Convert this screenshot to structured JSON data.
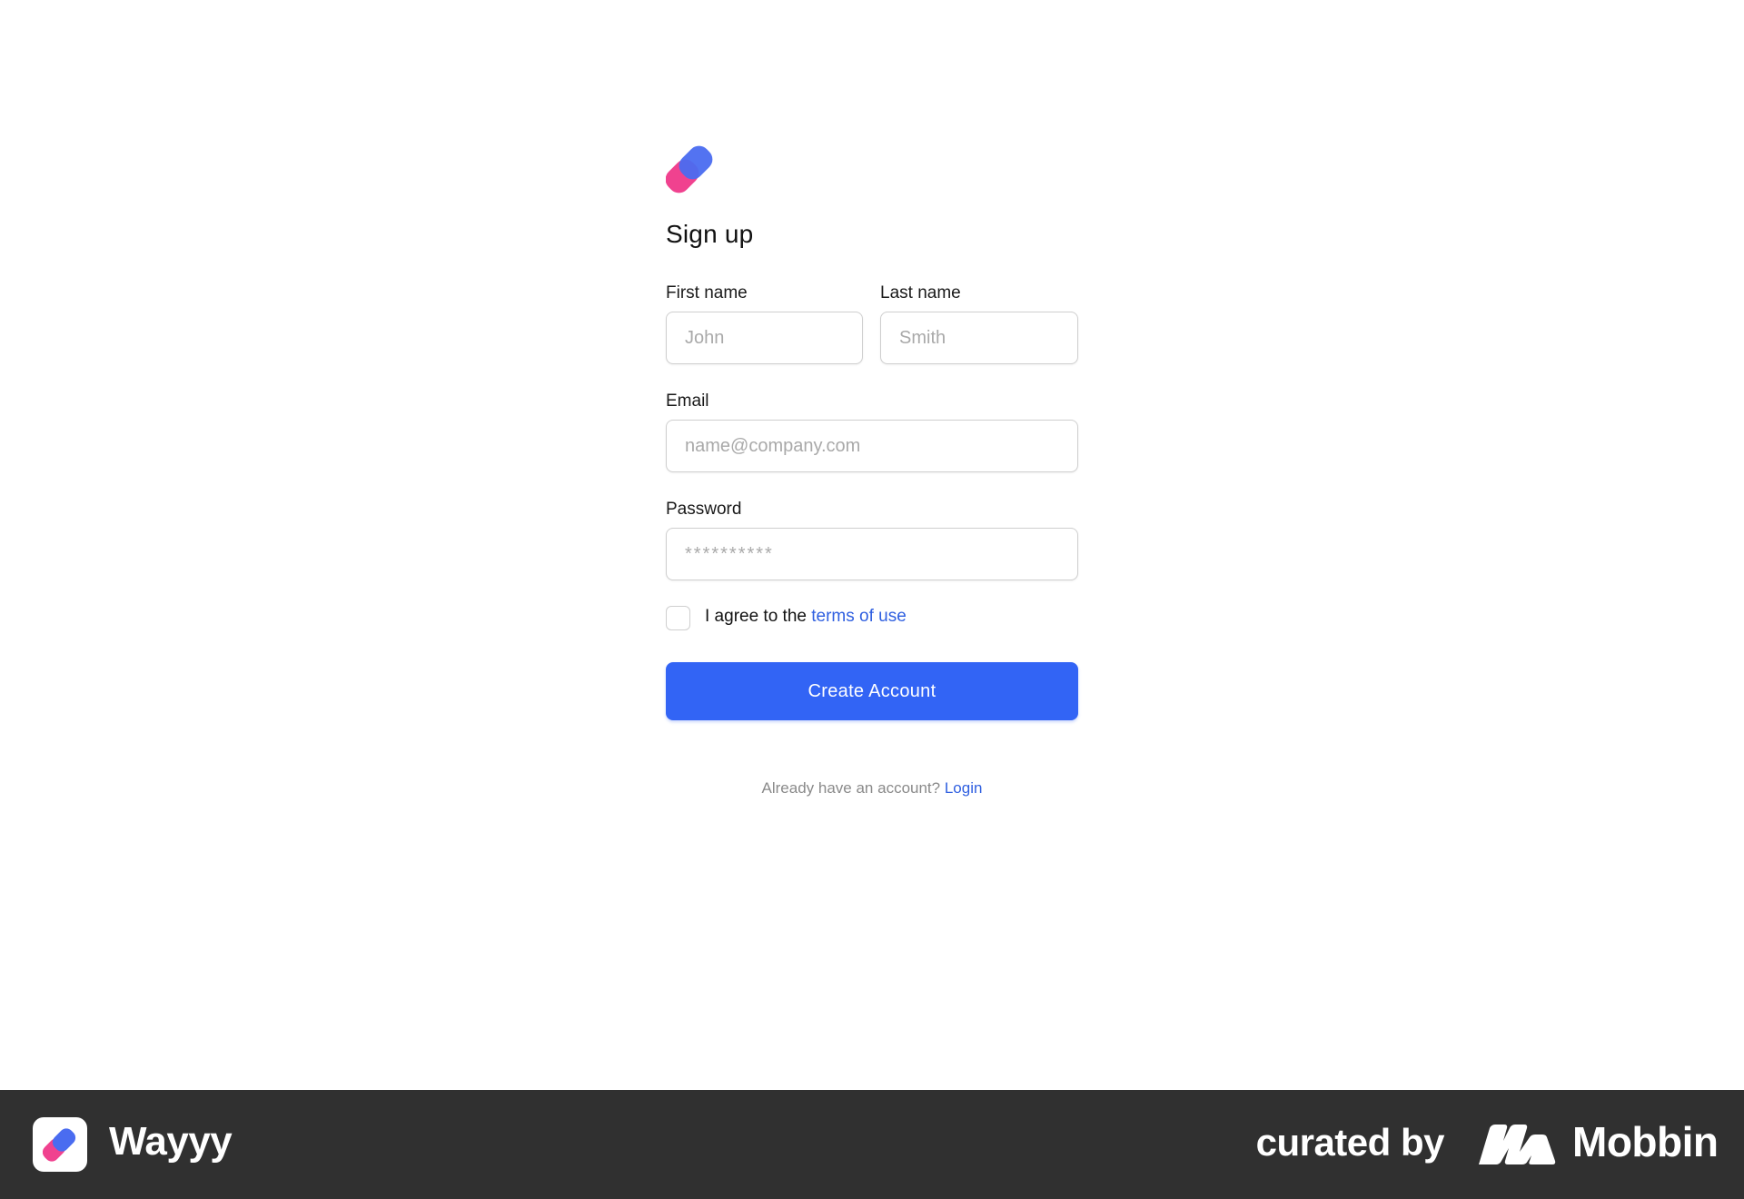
{
  "form": {
    "title": "Sign up",
    "first_name": {
      "label": "First name",
      "placeholder": "John",
      "value": ""
    },
    "last_name": {
      "label": "Last name",
      "placeholder": "Smith",
      "value": ""
    },
    "email": {
      "label": "Email",
      "placeholder": "name@company.com",
      "value": ""
    },
    "password": {
      "label": "Password",
      "placeholder": "**********",
      "value": ""
    },
    "agree": {
      "checked": false,
      "text": "I agree to the ",
      "link_text": "terms of use"
    },
    "submit_label": "Create Account",
    "login_prompt": "Already have an account? ",
    "login_link": "Login"
  },
  "footer": {
    "app_name": "Wayyy",
    "curated_by": "curated by",
    "brand": "Mobbin"
  },
  "colors": {
    "accent": "#3264f5",
    "link": "#2f5fe0",
    "logo_blue": "#4a6cf0",
    "logo_pink": "#f0428f",
    "footer_bg": "#303030"
  }
}
